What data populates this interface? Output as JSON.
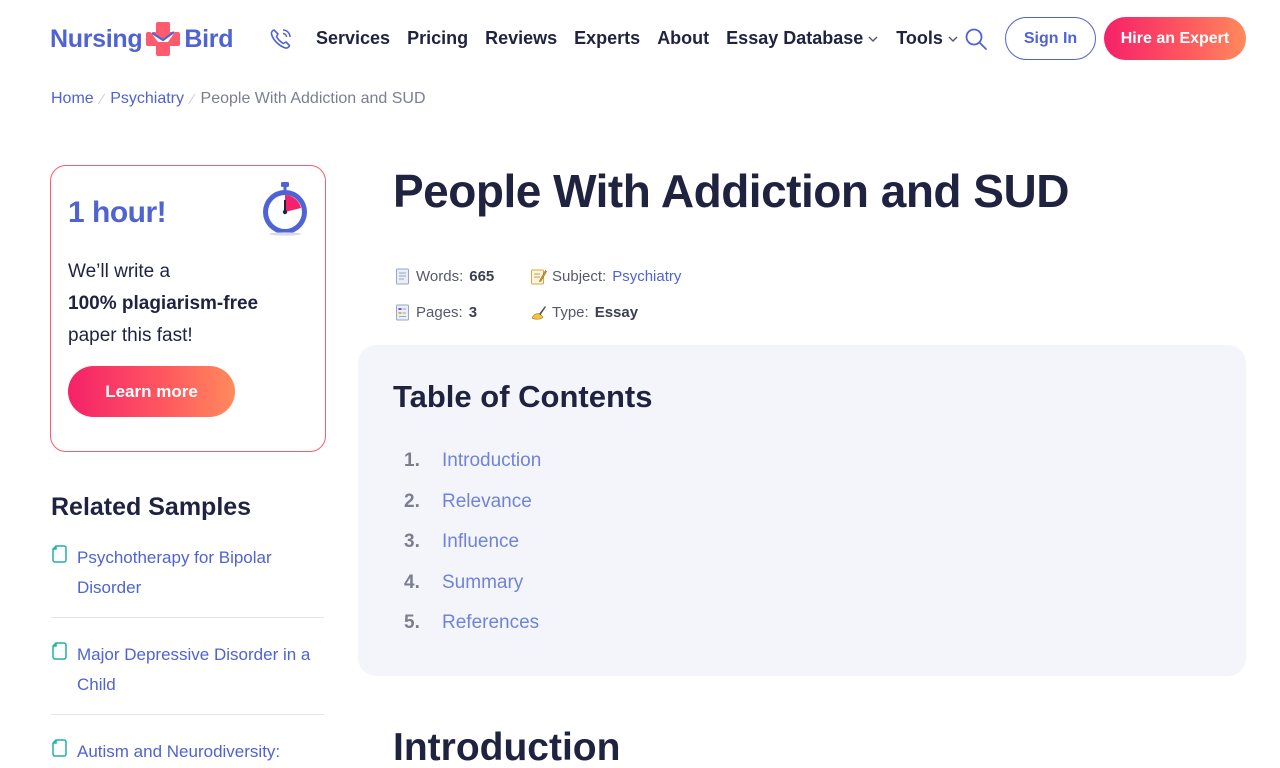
{
  "header": {
    "logo": {
      "left": "Nursing",
      "right": "Bird",
      "mark_icon": "cross-bird-logo-icon"
    },
    "phone_icon": "phone-icon",
    "nav": [
      {
        "label": "Services",
        "has_dropdown": false
      },
      {
        "label": "Pricing",
        "has_dropdown": false
      },
      {
        "label": "Reviews",
        "has_dropdown": false
      },
      {
        "label": "Experts",
        "has_dropdown": false
      },
      {
        "label": "About",
        "has_dropdown": false
      },
      {
        "label": "Essay Database",
        "has_dropdown": true
      },
      {
        "label": "Tools",
        "has_dropdown": true
      }
    ],
    "search_icon": "search-icon",
    "sign_in_label": "Sign In",
    "hire_label": "Hire an Expert"
  },
  "breadcrumb": {
    "items": [
      "Home",
      "Psychiatry"
    ],
    "current": "People With Addiction and SUD"
  },
  "promo": {
    "title": "1 hour!",
    "line1": "We’ll write a",
    "line2": "100% plagiarism-free",
    "line3": "paper this fast!",
    "button_label": "Learn more"
  },
  "related": {
    "title": "Related Samples",
    "items": [
      "Psychotherapy for Bipolar Disorder",
      "Major Depressive Disorder in a Child",
      "Autism and Neurodiversity:"
    ]
  },
  "article": {
    "title": "People With Addiction and SUD",
    "meta": {
      "words_label": "Words:",
      "words_value": "665",
      "subject_label": "Subject:",
      "subject_value": "Psychiatry",
      "pages_label": "Pages:",
      "pages_value": "3",
      "type_label": "Type:",
      "type_value": "Essay"
    },
    "toc": {
      "title": "Table of Contents",
      "items": [
        {
          "num": "1.",
          "label": "Introduction"
        },
        {
          "num": "2.",
          "label": "Relevance"
        },
        {
          "num": "3.",
          "label": "Influence"
        },
        {
          "num": "4.",
          "label": "Summary"
        },
        {
          "num": "5.",
          "label": "References"
        }
      ]
    },
    "first_section": "Introduction"
  },
  "colors": {
    "brand_blue": "#4f63d2",
    "accent_pink": "#f5216a",
    "accent_orange": "#ff8a5c",
    "text_dark": "#1f2340",
    "toc_bg": "#f4f5fa"
  }
}
